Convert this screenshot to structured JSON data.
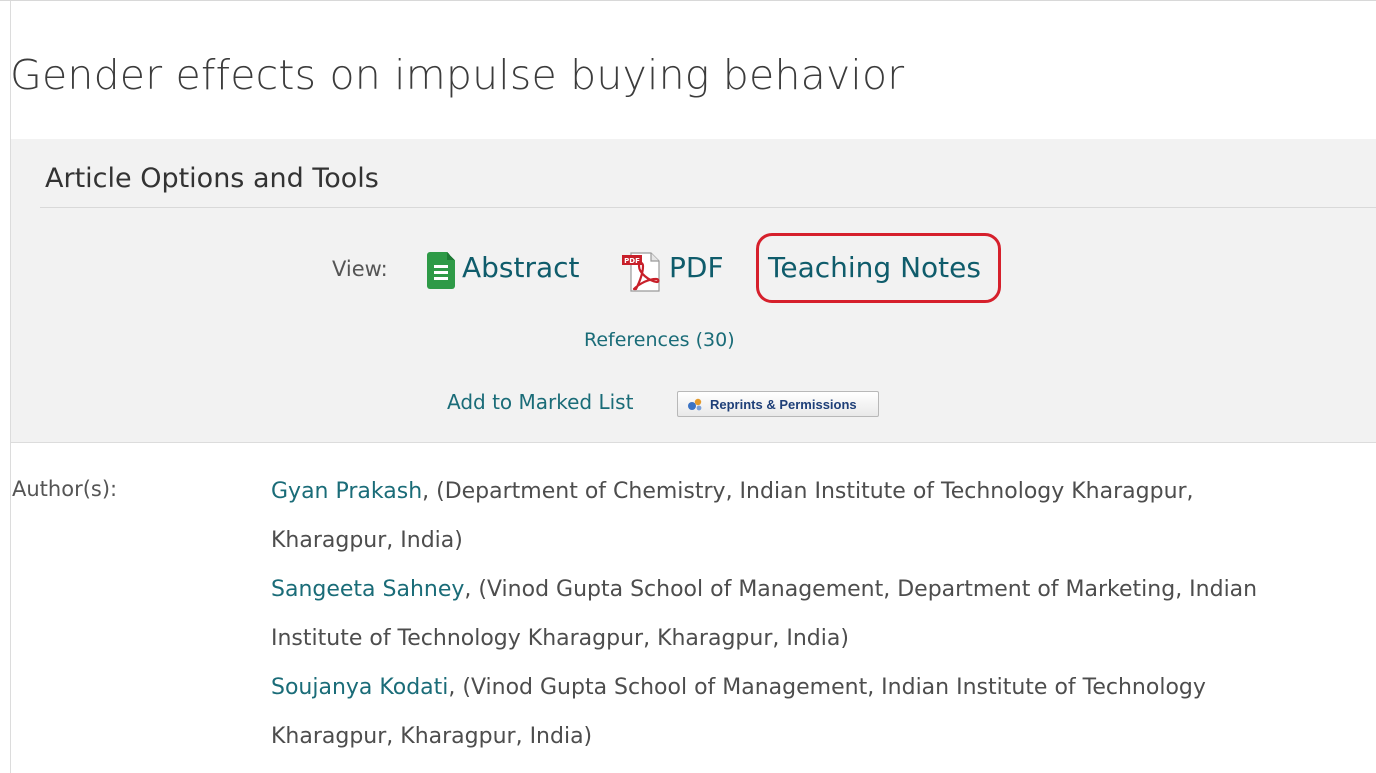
{
  "article": {
    "title": "Gender effects on impulse buying behavior"
  },
  "tools": {
    "heading": "Article Options and Tools",
    "view_label": "View:",
    "abstract_label": "Abstract",
    "pdf_label": "PDF",
    "pdf_icon_text": "PDF",
    "teaching_notes_label": "Teaching Notes",
    "references_label": "References (30)",
    "marked_list_label": "Add to Marked List",
    "reprints_label": "Reprints & Permissions"
  },
  "authors": {
    "label": "Author(s):",
    "entries": [
      {
        "name": "Gyan Prakash",
        "affiliation_line1": ", (Department of Chemistry, Indian Institute of Technology Kharagpur,",
        "affiliation_line2": "Kharagpur, India)"
      },
      {
        "name": "Sangeeta Sahney",
        "affiliation_line1": ", (Vinod Gupta School of Management, Department of Marketing, Indian",
        "affiliation_line2": "Institute of Technology Kharagpur, Kharagpur, India)"
      },
      {
        "name": "Soujanya Kodati",
        "affiliation_line1": ", (Vinod Gupta School of Management, Indian Institute of Technology",
        "affiliation_line2": "Kharagpur, Kharagpur, India)"
      }
    ]
  },
  "colors": {
    "link": "#1a6c78",
    "highlight": "#d6202c",
    "panel_bg": "#f2f2f2",
    "abstract_icon": "#2e9a47",
    "pdf_icon": "#c8202a"
  },
  "icons": {
    "abstract": "document-icon",
    "pdf": "pdf-icon",
    "reprints": "reprints-icon"
  }
}
